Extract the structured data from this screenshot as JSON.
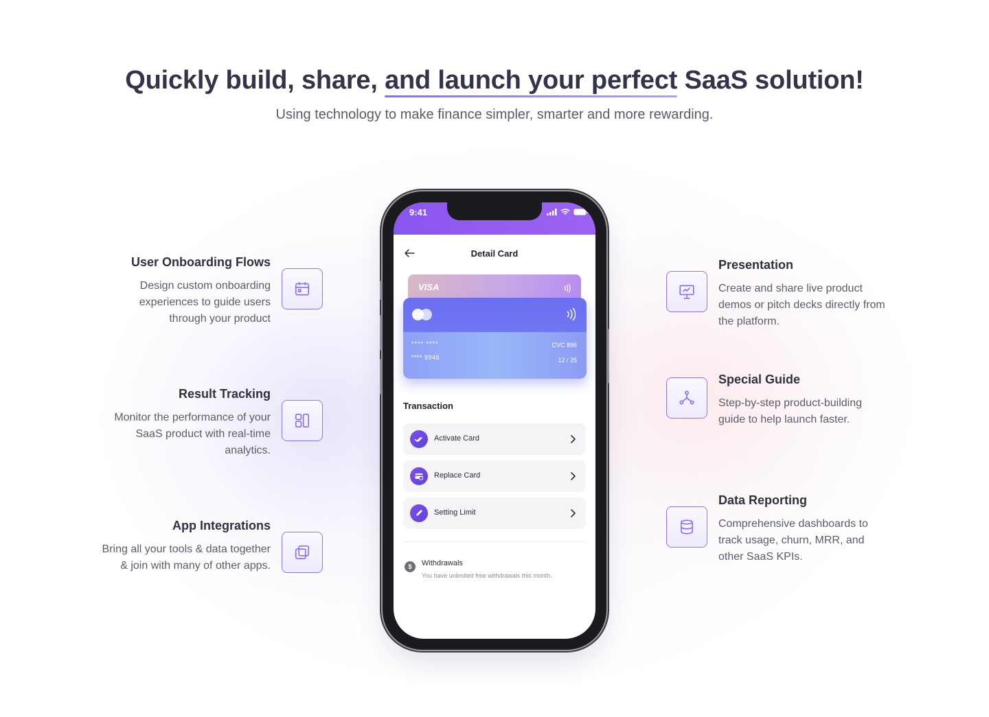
{
  "header": {
    "headline_part1": "Quickly build, share,",
    "headline_highlight": "and launch your perfect",
    "headline_part2": "SaaS solution!",
    "subtitle": "Using technology to make finance simpler, smarter and more rewarding."
  },
  "features_left": [
    {
      "title": "User Onboarding Flows",
      "desc": "Design custom onboarding experiences to guide users through your product",
      "icon": "calendar-icon"
    },
    {
      "title": "Result Tracking",
      "desc": "Monitor the performance of your SaaS product with real-time analytics.",
      "icon": "layout-icon"
    },
    {
      "title": "App Integrations",
      "desc": "Bring all your tools & data together & join with many of other apps.",
      "icon": "copy-icon"
    }
  ],
  "features_right": [
    {
      "title": "Presentation",
      "desc": "Create and share live product demos or pitch decks directly from the platform.",
      "icon": "presentation-chart-icon"
    },
    {
      "title": "Special Guide",
      "desc": "Step-by-step product-building guide to help launch faster.",
      "icon": "network-icon"
    },
    {
      "title": "Data Reporting",
      "desc": "Comprehensive dashboards to track usage, churn, MRR, and other SaaS KPIs.",
      "icon": "database-icon"
    }
  ],
  "phone": {
    "time": "9:41",
    "screen_title": "Detail Card",
    "card_back_brand": "VISA",
    "card_number_line1": "****  ****",
    "card_number_line2": "****  9946",
    "cvc": "CVC 896",
    "expiry": "12 / 25",
    "section_title": "Transaction",
    "actions": [
      {
        "label": "Activate Card",
        "icon": "check-double-icon"
      },
      {
        "label": "Replace Card",
        "icon": "card-swap-icon"
      },
      {
        "label": "Setting Limit",
        "icon": "pen-icon"
      }
    ],
    "withdrawals_title": "Withdrawals",
    "withdrawals_desc": "You have unlimited free withdrawals this month.",
    "withdrawals_icon_symbol": "$"
  },
  "colors": {
    "accent": "#8f74ef",
    "phone_header": "#8a55f0",
    "action_icon": "#6e48e4"
  }
}
